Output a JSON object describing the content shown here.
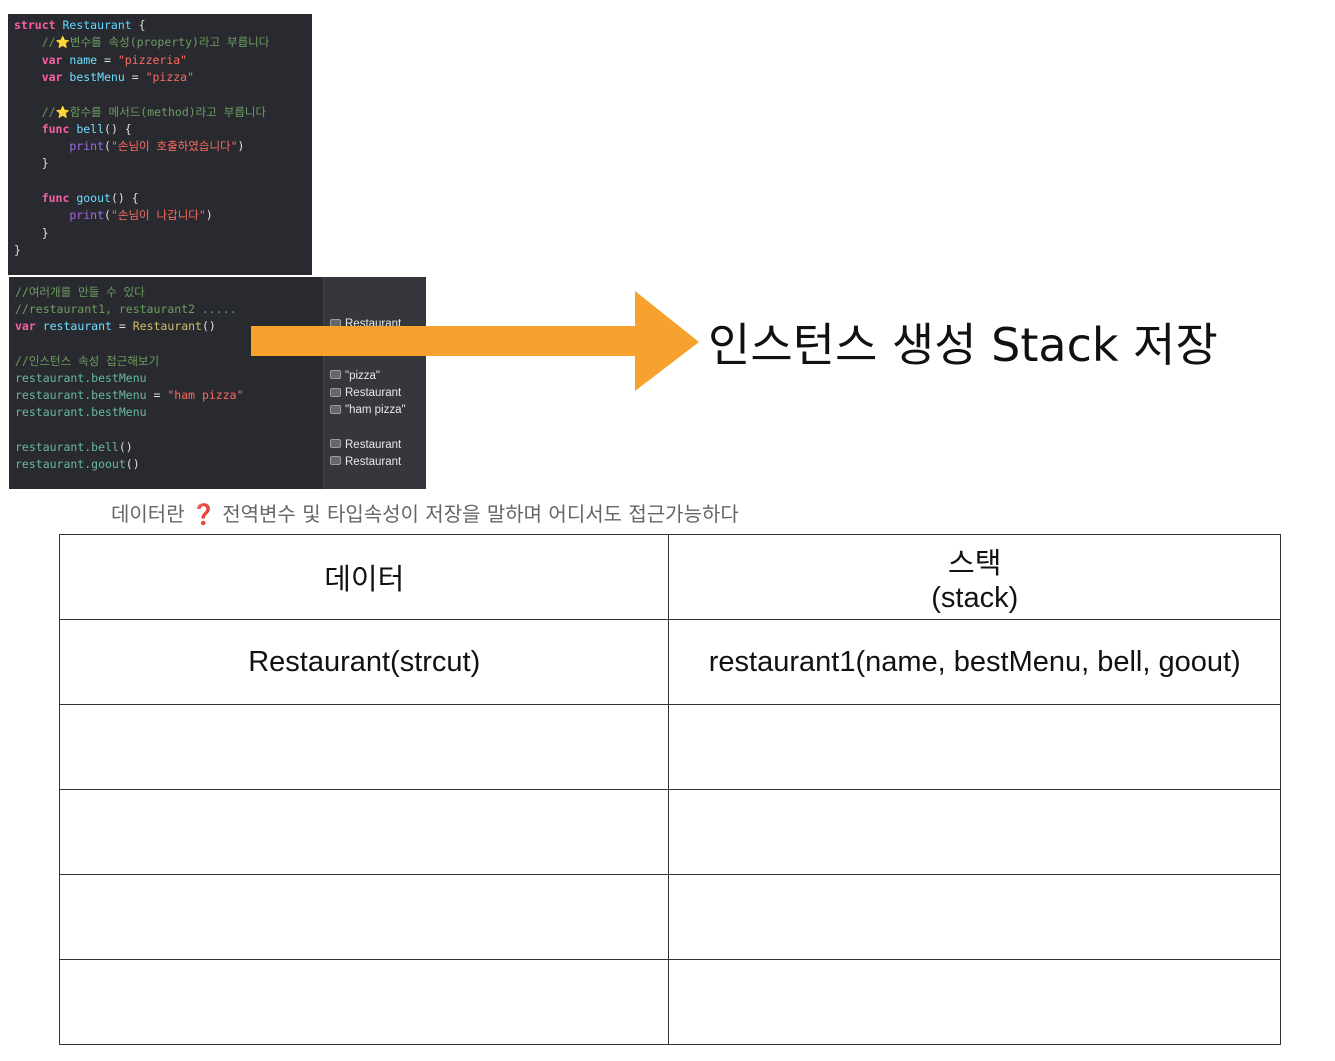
{
  "code_top": {
    "lines": [
      [
        [
          "kw",
          "struct "
        ],
        [
          "ty",
          "Restaurant"
        ],
        [
          "pl",
          " {"
        ]
      ],
      [
        [
          "cm",
          "    //"
        ],
        [
          "emoji",
          "⭐"
        ],
        [
          "cm",
          "변수를 속성(property)라고 부릅니다"
        ]
      ],
      [
        [
          "kw",
          "    var "
        ],
        [
          "nm",
          "name"
        ],
        [
          "pl",
          " = "
        ],
        [
          "str",
          "\"pizzeria\""
        ]
      ],
      [
        [
          "kw",
          "    var "
        ],
        [
          "nm",
          "bestMenu"
        ],
        [
          "pl",
          " = "
        ],
        [
          "str",
          "\"pizza\""
        ]
      ],
      [
        [
          "pl",
          ""
        ]
      ],
      [
        [
          "cm",
          "    //"
        ],
        [
          "emoji",
          "⭐"
        ],
        [
          "cm",
          "함수를 메서드(method)라고 부릅니다"
        ]
      ],
      [
        [
          "kw",
          "    func "
        ],
        [
          "nm",
          "bell"
        ],
        [
          "pl",
          "() {"
        ]
      ],
      [
        [
          "fn",
          "        print"
        ],
        [
          "pl",
          "("
        ],
        [
          "str",
          "\"손님이 호출하였습니다\""
        ],
        [
          "pl",
          ")"
        ]
      ],
      [
        [
          "pl",
          "    }"
        ]
      ],
      [
        [
          "pl",
          ""
        ]
      ],
      [
        [
          "kw",
          "    func "
        ],
        [
          "nm",
          "goout"
        ],
        [
          "pl",
          "() {"
        ]
      ],
      [
        [
          "fn",
          "        print"
        ],
        [
          "pl",
          "("
        ],
        [
          "str",
          "\"손님이 나갑니다\""
        ],
        [
          "pl",
          ")"
        ]
      ],
      [
        [
          "pl",
          "    }"
        ]
      ],
      [
        [
          "pl",
          "}"
        ]
      ]
    ]
  },
  "code_bottom": {
    "lines": [
      [
        [
          "cm",
          "//여러개를 만들 수 있다"
        ]
      ],
      [
        [
          "cm",
          "//restaurant1, restaurant2 ....."
        ]
      ],
      [
        [
          "kw",
          "var "
        ],
        [
          "nm",
          "restaurant"
        ],
        [
          "pl",
          " = "
        ],
        [
          "cl",
          "Restaurant"
        ],
        [
          "pl",
          "()"
        ]
      ],
      [
        [
          "pl",
          ""
        ]
      ],
      [
        [
          "cm",
          "//인스턴스 속성 접근해보기"
        ]
      ],
      [
        [
          "prop",
          "restaurant.bestMenu"
        ]
      ],
      [
        [
          "prop",
          "restaurant.bestMenu"
        ],
        [
          "pl",
          " = "
        ],
        [
          "str",
          "\"ham pizza\""
        ]
      ],
      [
        [
          "prop",
          "restaurant.bestMenu"
        ]
      ],
      [
        [
          "pl",
          ""
        ]
      ],
      [
        [
          "prop",
          "restaurant.bell"
        ],
        [
          "pl",
          "()"
        ]
      ],
      [
        [
          "prop",
          "restaurant.goout"
        ],
        [
          "pl",
          "()"
        ]
      ]
    ],
    "results": [
      {
        "row": 2,
        "text": "Restaurant"
      },
      {
        "row": 5,
        "text": "\"pizza\""
      },
      {
        "row": 6,
        "text": "Restaurant"
      },
      {
        "row": 7,
        "text": "\"ham pizza\""
      },
      {
        "row": 9,
        "text": "Restaurant"
      },
      {
        "row": 10,
        "text": "Restaurant"
      }
    ]
  },
  "arrow_color": "#f7a22e",
  "headline": "인스턴스 생성 Stack 저장",
  "note": {
    "prefix": "데이터란",
    "mark": "❓",
    "text": " 전역변수 및 타입속성이 저장을 말하며 어디서도 접근가능하다",
    "mark_color": "#e0302c"
  },
  "table": {
    "header_left": "데이터",
    "header_right_line1": "스택",
    "header_right_line2": "(stack)",
    "rows": [
      [
        "Restaurant(strcut)",
        "restaurant1(name, bestMenu, bell, goout)"
      ],
      [
        "",
        ""
      ],
      [
        "",
        ""
      ],
      [
        "",
        ""
      ],
      [
        "",
        ""
      ]
    ]
  }
}
